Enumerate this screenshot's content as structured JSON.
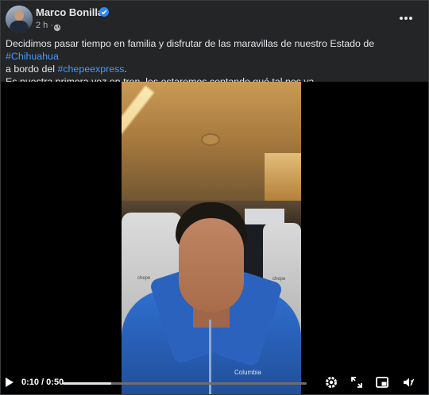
{
  "post": {
    "author": "Marco Bonilla",
    "time": "2 h ·",
    "text": {
      "line1_prefix": "Decidimos pasar tiempo en familia y disfrutar de las maravillas de nuestro Estado de ",
      "hashtag1": "#Chihuahua",
      "line2_prefix": "a bordo del ",
      "hashtag2": "#chepeexpress",
      "line2_suffix": ".",
      "line3": "Es nuestra primera vez en tren, les estaremos contando qué tal nos va."
    }
  },
  "video": {
    "seat_label_left": "chepe",
    "seat_label_right": "chepe",
    "jacket_logo": "Columbia",
    "time_display": "0:10 / 0:50",
    "progress": 0.2
  },
  "icons": {
    "verified": "verified-badge-icon",
    "privacy": "globe-icon",
    "more": "more-options-icon",
    "play": "play-icon",
    "settings": "gear-icon",
    "expand": "expand-icon",
    "pip": "picture-in-picture-icon",
    "volume": "volume-icon"
  },
  "colors": {
    "background": "#242526",
    "link": "#4599ff",
    "verified": "#2d88ff"
  }
}
